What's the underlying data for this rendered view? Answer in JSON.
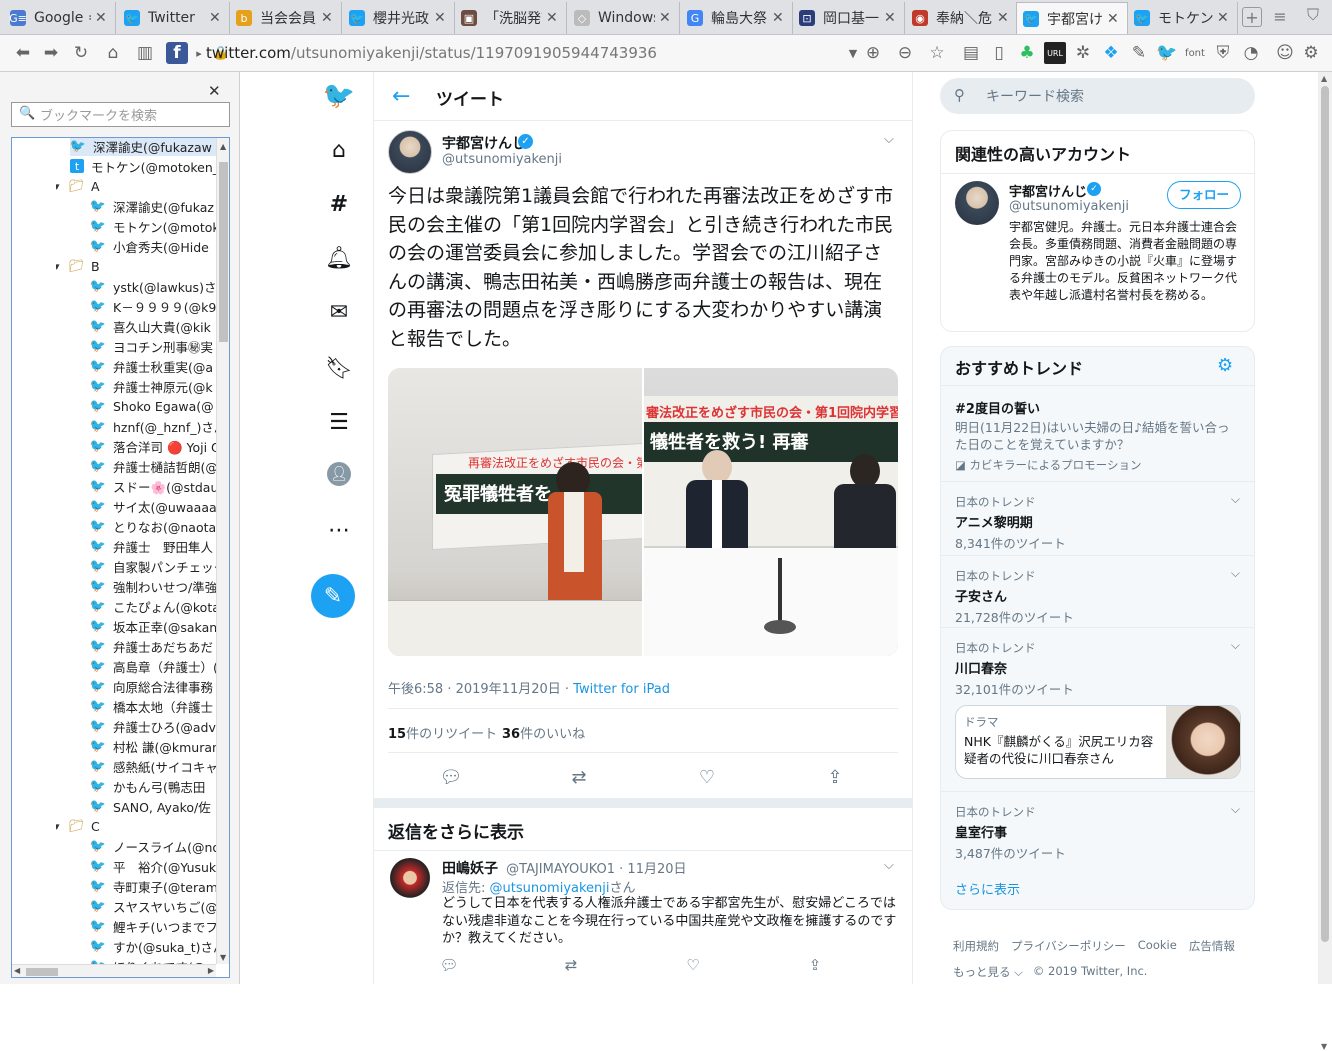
{
  "tabs": [
    {
      "title": "Google =",
      "fav": "G≡",
      "color": "#4a7bd0"
    },
    {
      "title": "Twitter",
      "fav": "🐦",
      "color": "#1da1f2"
    },
    {
      "title": "当会会員",
      "fav": "b",
      "color": "#e4a11b"
    },
    {
      "title": "櫻井光政",
      "fav": "🐦",
      "color": "#1da1f2"
    },
    {
      "title": "「洗脳発言",
      "fav": "▣",
      "color": "#6d4c41"
    },
    {
      "title": "Windows",
      "fav": "◇",
      "color": "#bbb"
    },
    {
      "title": "輪島大祭",
      "fav": "G",
      "color": "#4285f4"
    },
    {
      "title": "岡口基一",
      "fav": "⊡",
      "color": "#2c3e7a"
    },
    {
      "title": "奉納＼危",
      "fav": "◉",
      "color": "#c0392b"
    },
    {
      "title": "宇都宮け",
      "fav": "🐦",
      "color": "#1da1f2",
      "active": true
    },
    {
      "title": "モトケン(",
      "fav": "🐦",
      "color": "#1da1f2"
    }
  ],
  "url": {
    "host": "twitter.com",
    "path": "/utsunomiyakenji/status/1197091905944743936"
  },
  "sidebar": {
    "search_placeholder": "ブックマークを検索",
    "items": [
      {
        "label": "深澤諭史(@fukazaw",
        "indent": 1,
        "type": "bird",
        "partial": true
      },
      {
        "label": "モトケン(@motoken_",
        "indent": 1,
        "type": "t"
      },
      {
        "label": "A",
        "indent": 0,
        "type": "folder"
      },
      {
        "label": "深澤諭史(@fukaz",
        "indent": 2,
        "type": "bird"
      },
      {
        "label": "モトケン(@motoke",
        "indent": 2,
        "type": "bird"
      },
      {
        "label": "小倉秀夫(@Hide",
        "indent": 2,
        "type": "bird"
      },
      {
        "label": "B",
        "indent": 0,
        "type": "folder"
      },
      {
        "label": "ystk(@lawkus)さん",
        "indent": 2,
        "type": "bird"
      },
      {
        "label": "K－９９９９(@k99",
        "indent": 2,
        "type": "bird"
      },
      {
        "label": "喜久山大貴(@kik",
        "indent": 2,
        "type": "bird"
      },
      {
        "label": "ヨコチン刑事㊙実",
        "indent": 2,
        "type": "bird"
      },
      {
        "label": "弁護士秋重実(@a",
        "indent": 2,
        "type": "bird"
      },
      {
        "label": "弁護士神原元(@k",
        "indent": 2,
        "type": "bird"
      },
      {
        "label": "Shoko Egawa(@",
        "indent": 2,
        "type": "bird"
      },
      {
        "label": "hznf(@_hznf_)さん",
        "indent": 2,
        "type": "bird"
      },
      {
        "label": "落合洋司 🔴 Yoji O",
        "indent": 2,
        "type": "bird"
      },
      {
        "label": "弁護士樋詰哲朗(@",
        "indent": 2,
        "type": "bird"
      },
      {
        "label": "スドー🌸(@stdau",
        "indent": 2,
        "type": "bird"
      },
      {
        "label": "サイ太(@uwaaaa)",
        "indent": 2,
        "type": "bird"
      },
      {
        "label": "とりなお(@naotar",
        "indent": 2,
        "type": "bird"
      },
      {
        "label": "弁護士　野田隼人",
        "indent": 2,
        "type": "bird"
      },
      {
        "label": "自家製パンチェッタ",
        "indent": 2,
        "type": "bird"
      },
      {
        "label": "強制わいせつ/準強",
        "indent": 2,
        "type": "bird"
      },
      {
        "label": "こたぴょん(@kotac",
        "indent": 2,
        "type": "bird"
      },
      {
        "label": "坂本正幸(@sakan",
        "indent": 2,
        "type": "bird"
      },
      {
        "label": "弁護士あだちあだ",
        "indent": 2,
        "type": "bird"
      },
      {
        "label": "高島章（弁護士）(@",
        "indent": 2,
        "type": "bird"
      },
      {
        "label": "向原総合法律事務",
        "indent": 2,
        "type": "bird"
      },
      {
        "label": "橋本太地（弁護士",
        "indent": 2,
        "type": "bird"
      },
      {
        "label": "弁護士ひろ(@adv",
        "indent": 2,
        "type": "bird"
      },
      {
        "label": "村松 謙(@kmuran",
        "indent": 2,
        "type": "bird"
      },
      {
        "label": "感熱紙(サイコキャ",
        "indent": 2,
        "type": "bird"
      },
      {
        "label": "かもん弓(鴨志田",
        "indent": 2,
        "type": "bird"
      },
      {
        "label": "SANO, Ayako/佐",
        "indent": 2,
        "type": "bird"
      },
      {
        "label": "C",
        "indent": 0,
        "type": "folder"
      },
      {
        "label": "ノースライム(@noo",
        "indent": 2,
        "type": "bird"
      },
      {
        "label": "平　裕介(@Yusuk",
        "indent": 2,
        "type": "bird"
      },
      {
        "label": "寺町東子(@teram",
        "indent": 2,
        "type": "bird"
      },
      {
        "label": "スヤスヤいちご(@",
        "indent": 2,
        "type": "bird"
      },
      {
        "label": "鯉キチ(いつまでフ",
        "indent": 2,
        "type": "bird"
      },
      {
        "label": "すか(@suka_t)さん",
        "indent": 2,
        "type": "bird"
      },
      {
        "label": "ほりぐちです(@ms",
        "indent": 2,
        "type": "bird"
      }
    ]
  },
  "header": {
    "title": "ツイート"
  },
  "tweet": {
    "name": "宇都宮けんじ",
    "handle": "@utsunomiyakenji",
    "text": "今日は衆議院第1議員会館で行われた再審法改正をめざす市民の会主催の「第1回院内学習会」と引き続き行われた市民の会の運営委員会に参加しました。学習会での江川紹子さんの講演、鴨志田祐美・西嶋勝彦両弁護士の報告は、現在の再審法の問題点を浮き彫りにする大変わかりやすい講演と報告でした。",
    "photo1_banner": "再審法改正をめざす市民の会・第1",
    "photo1_main": "冤罪犠牲者を",
    "photo2_banner": "審法改正をめざす市民の会・第1回院内学習",
    "photo2_main": "犠牲者を救う! 再審",
    "time": "午後6:58 · 2019年11月20日 · ",
    "via": "Twitter for iPad",
    "retweets_n": "15",
    "retweets_l": "件のリツイート",
    "likes_n": "36",
    "likes_l": "件のいいね"
  },
  "more_replies": "返信をさらに表示",
  "reply": {
    "name": "田嶋妖子",
    "handle": "@TAJIMAYOUKO1 · 11月20日",
    "to_label": "返信先: ",
    "to_handle": "@utsunomiyakenji",
    "to_suffix": "さん",
    "text": "どうして日本を代表する人権派弁護士である宇都宮先生が、慰安婦どころではない残虐非道なことを今現在行っている中国共産党や文政権を擁護するのですか？教えてください。"
  },
  "search": {
    "placeholder": "キーワード検索"
  },
  "related": {
    "title": "関連性の高いアカウント",
    "name": "宇都宮けんじ",
    "handle": "@utsunomiyakenji",
    "follow": "フォロー",
    "bio": "宇都宮健児。弁護士。元日本弁護士連合会会長。多重債務問題、消費者金融問題の専門家。宮部みゆきの小説『火車』に登場する弁護士のモデル。反貧困ネットワーク代表や年越し派遣村名誉村長を務める。"
  },
  "trends": {
    "title": "おすすめトレンド",
    "promoted": {
      "tag": "#2度目の誓い",
      "desc": "明日(11月22日)はいい夫婦の日♪結婚を誓い合った日のことを覚えていますか？",
      "by": "カビキラーによるプロモーション"
    },
    "items": [
      {
        "context": "日本のトレンド",
        "name": "アニメ黎明期",
        "count": "8,341件のツイート"
      },
      {
        "context": "日本のトレンド",
        "name": "子安さん",
        "count": "21,728件のツイート"
      },
      {
        "context": "日本のトレンド",
        "name": "川口春奈",
        "count": "32,101件のツイート"
      },
      {
        "context": "日本のトレンド",
        "name": "皇室行事",
        "count": "3,487件のツイート"
      }
    ],
    "news": {
      "category": "ドラマ",
      "text": "NHK『麒麟がくる』沢尻エリカ容疑者の代役に川口春奈さん"
    },
    "more": "さらに表示"
  },
  "footer": {
    "links": [
      "利用規約",
      "プライバシーポリシー",
      "Cookie",
      "広告情報"
    ],
    "more": "もっと見る ⌵",
    "copy": "© 2019 Twitter, Inc."
  }
}
